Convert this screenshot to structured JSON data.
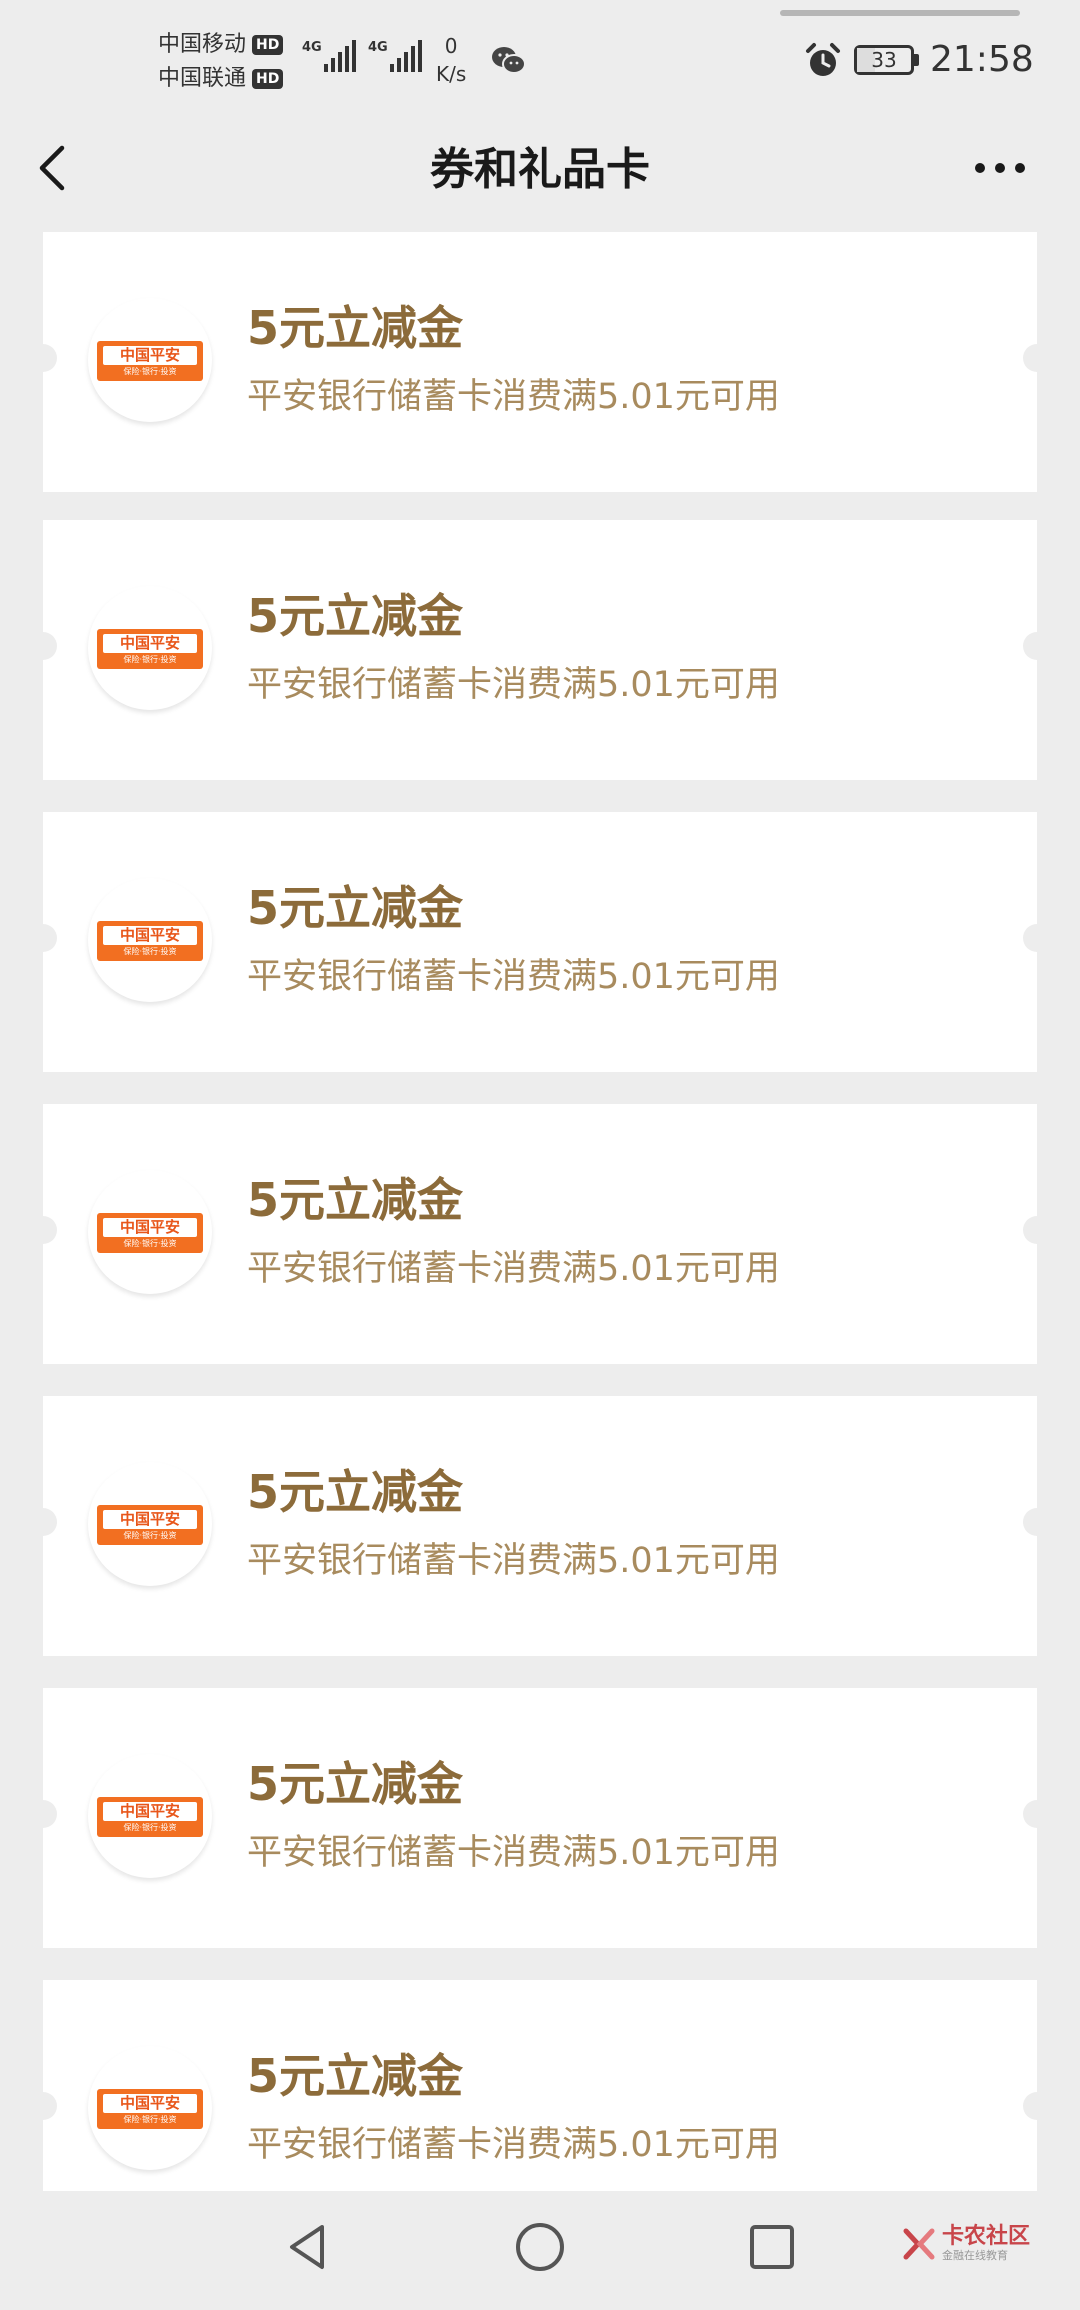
{
  "status_bar": {
    "carrier_1": "中国移动",
    "carrier_2": "中国联通",
    "hd_badge": "HD",
    "network_1": "4G",
    "network_2": "4G",
    "net_speed_value": "0",
    "net_speed_unit": "K/s",
    "battery_level": "33",
    "time": "21:58"
  },
  "header": {
    "title": "券和礼品卡"
  },
  "coupon_logo": {
    "name": "中国平安",
    "tagline": "保险·银行·投资"
  },
  "coupons": [
    {
      "title": "5元立减金",
      "description": "平安银行储蓄卡消费满5.01元可用"
    },
    {
      "title": "5元立减金",
      "description": "平安银行储蓄卡消费满5.01元可用"
    },
    {
      "title": "5元立减金",
      "description": "平安银行储蓄卡消费满5.01元可用"
    },
    {
      "title": "5元立减金",
      "description": "平安银行储蓄卡消费满5.01元可用"
    },
    {
      "title": "5元立减金",
      "description": "平安银行储蓄卡消费满5.01元可用"
    },
    {
      "title": "5元立减金",
      "description": "平安银行储蓄卡消费满5.01元可用"
    },
    {
      "title": "5元立减金",
      "description": "平安银行储蓄卡消费满5.01元可用"
    }
  ],
  "watermark": {
    "name": "卡农社区",
    "subtitle": "金融在线教育"
  },
  "colors": {
    "background": "#ededed",
    "card": "#ffffff",
    "coupon_title": "#8c6b3a",
    "coupon_desc": "#a88b5e",
    "logo_orange": "#f26f21"
  }
}
